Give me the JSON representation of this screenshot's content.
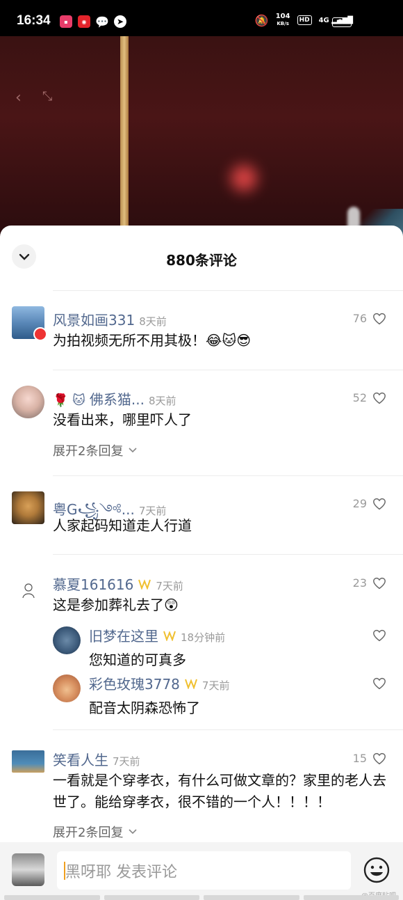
{
  "status": {
    "time": "16:34",
    "net_speed": "104",
    "net_unit": "KB/s",
    "hd": "HD",
    "signal": "4G",
    "battery": "68"
  },
  "sheet": {
    "title": "880条评论"
  },
  "comments": [
    {
      "name": "风景如画331",
      "time": "8天前",
      "likes": "76",
      "text": "为拍视频无所不用其极！😂🐱😎"
    },
    {
      "name_prefix": "🌹 🐱",
      "name": "佛系猫...",
      "time": "8天前",
      "likes": "52",
      "text": "没看出来，哪里吓人了",
      "expand": "展开2条回复"
    },
    {
      "name": "粤G꧁༺...",
      "time": "7天前",
      "likes": "29",
      "text": "人家起码知道走人行道"
    },
    {
      "name": "慕夏161616",
      "time": "7天前",
      "likes": "23",
      "text": "这是参加葬礼去了😲",
      "replies": [
        {
          "name": "旧梦在这里",
          "time": "18分钟前",
          "text": "您知道的可真多"
        },
        {
          "name": "彩色玫瑰3778",
          "time": "7天前",
          "text": "配音太阴森恐怖了"
        }
      ]
    },
    {
      "name": "笑看人生",
      "time": "7天前",
      "likes": "15",
      "text": "一看就是个穿孝衣，有什么可做文章的？家里的老人去世了。能给穿孝衣，很不错的一个人！！！！",
      "expand": "展开2条回复"
    }
  ],
  "input": {
    "placeholder": "黑呀耶  发表评论"
  },
  "watermark": "@百度贴吧",
  "icons": [
    "back-icon",
    "minimize-icon",
    "chevron-down-icon",
    "heart-icon",
    "emoji-icon",
    "vip-badge-icon"
  ],
  "colors": {
    "name": "#52688e",
    "accent_badge": "#f0c030",
    "cursor": "#f0a020"
  }
}
